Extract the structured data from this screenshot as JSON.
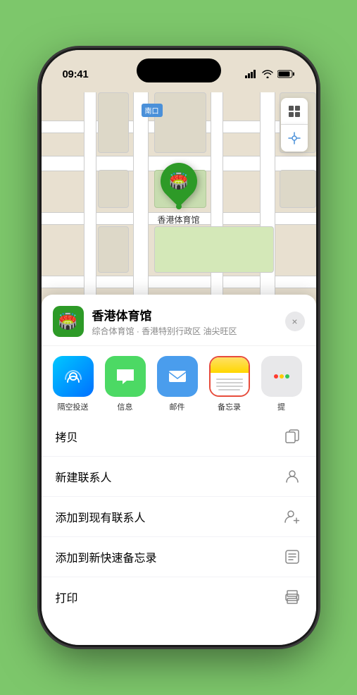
{
  "statusBar": {
    "time": "09:41",
    "locationIcon": "▶"
  },
  "map": {
    "locationLabel": "南口",
    "pinLabel": "香港体育馆"
  },
  "venueCard": {
    "venueName": "香港体育馆",
    "venueDesc": "综合体育馆 · 香港特别行政区 油尖旺区",
    "closeLabel": "×"
  },
  "shareApps": [
    {
      "id": "airdrop",
      "label": "隔空投送",
      "type": "airdrop"
    },
    {
      "id": "messages",
      "label": "信息",
      "type": "messages"
    },
    {
      "id": "mail",
      "label": "邮件",
      "type": "mail"
    },
    {
      "id": "notes",
      "label": "备忘录",
      "type": "notes"
    },
    {
      "id": "more",
      "label": "提",
      "type": "more"
    }
  ],
  "actions": [
    {
      "id": "copy",
      "label": "拷贝",
      "icon": "copy"
    },
    {
      "id": "new-contact",
      "label": "新建联系人",
      "icon": "person-add"
    },
    {
      "id": "add-contact",
      "label": "添加到现有联系人",
      "icon": "person-plus"
    },
    {
      "id": "quick-note",
      "label": "添加到新快速备忘录",
      "icon": "note"
    },
    {
      "id": "print",
      "label": "打印",
      "icon": "printer"
    }
  ]
}
